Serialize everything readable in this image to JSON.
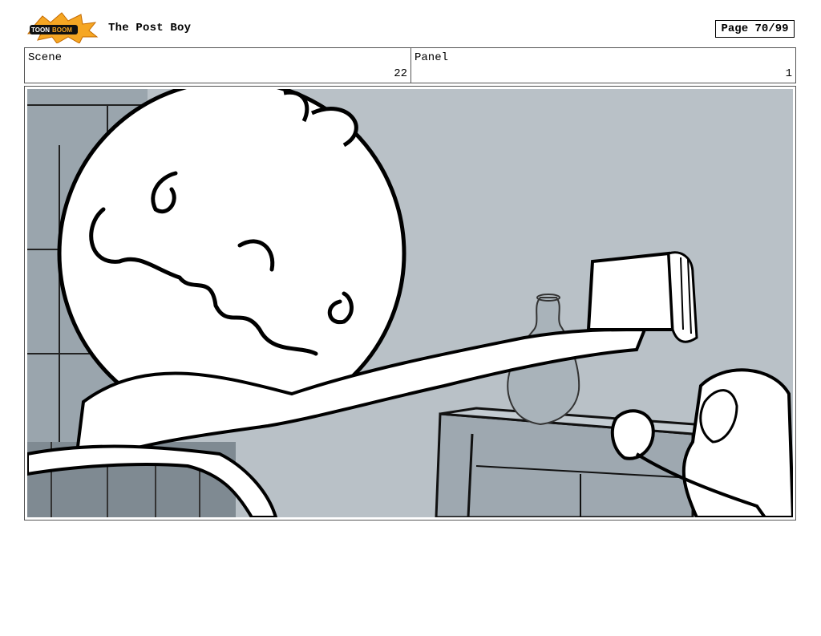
{
  "header": {
    "logo_text": "TOON BOOM",
    "title": "The Post Boy",
    "page": "Page 70/99"
  },
  "info": {
    "scene_label": "Scene",
    "scene_value": "22",
    "panel_label": "Panel",
    "panel_value": "1"
  },
  "colors": {
    "panel_bg": "#b8c0c6",
    "shadow": "#8f9aa2",
    "line": "#000000",
    "logo_orange": "#f5a623"
  }
}
